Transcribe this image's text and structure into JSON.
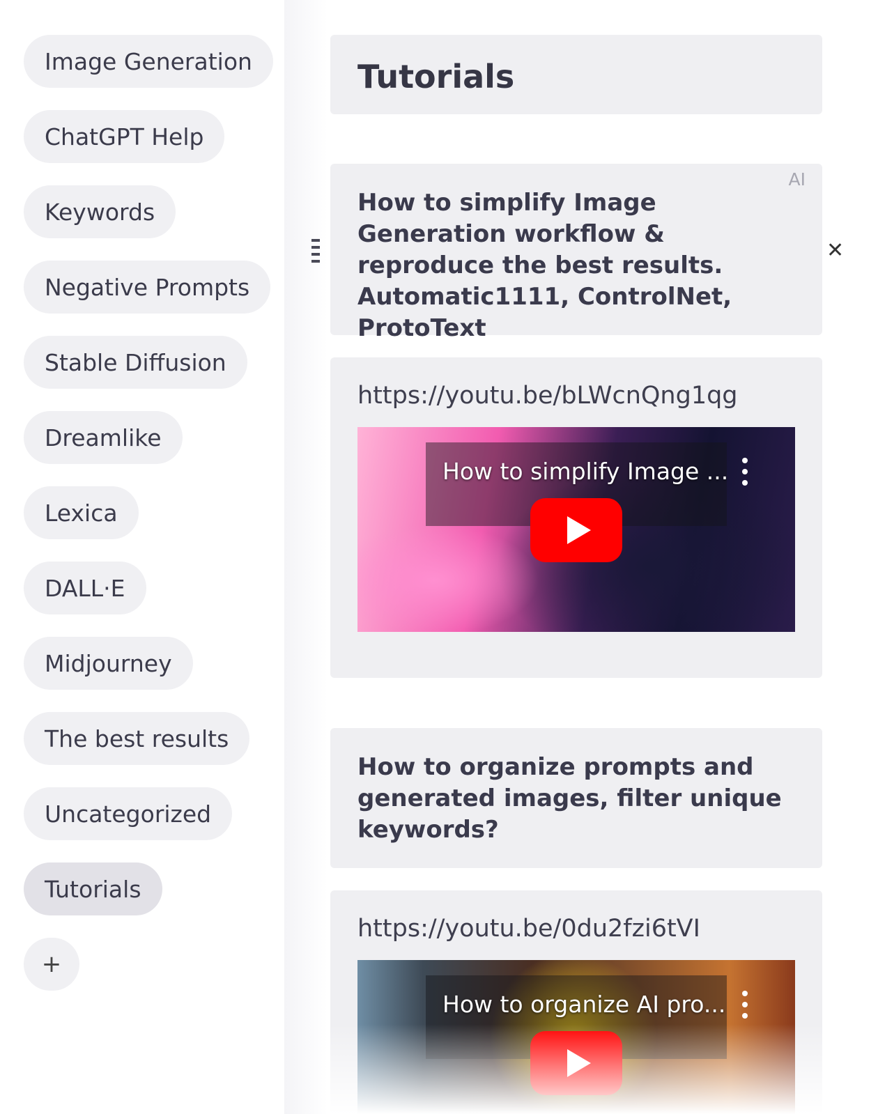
{
  "sidebar": {
    "items": [
      {
        "label": "Image Generation"
      },
      {
        "label": "ChatGPT Help"
      },
      {
        "label": "Keywords"
      },
      {
        "label": "Negative Prompts"
      },
      {
        "label": "Stable Diffusion"
      },
      {
        "label": "Dreamlike"
      },
      {
        "label": "Lexica"
      },
      {
        "label": "DALL·E"
      },
      {
        "label": "Midjourney"
      },
      {
        "label": "The best results"
      },
      {
        "label": "Uncategorized"
      },
      {
        "label": "Tutorials",
        "active": true
      }
    ],
    "add_label": "+"
  },
  "main": {
    "title": "Tutorials",
    "cards": [
      {
        "badge": "AI",
        "heading": "How to simplify Image Generation workflow & reproduce the best results. Automatic1111, ControlNet, ProtoText",
        "url": "https://youtu.be/bLWcnQng1qg",
        "video_title": "How to simplify Image ..."
      },
      {
        "heading": "How to organize prompts and generated images, filter unique keywords?",
        "url": "https://youtu.be/0du2fzi6tVI",
        "video_title": "How to organize AI pro..."
      }
    ],
    "close_label": "✕"
  }
}
